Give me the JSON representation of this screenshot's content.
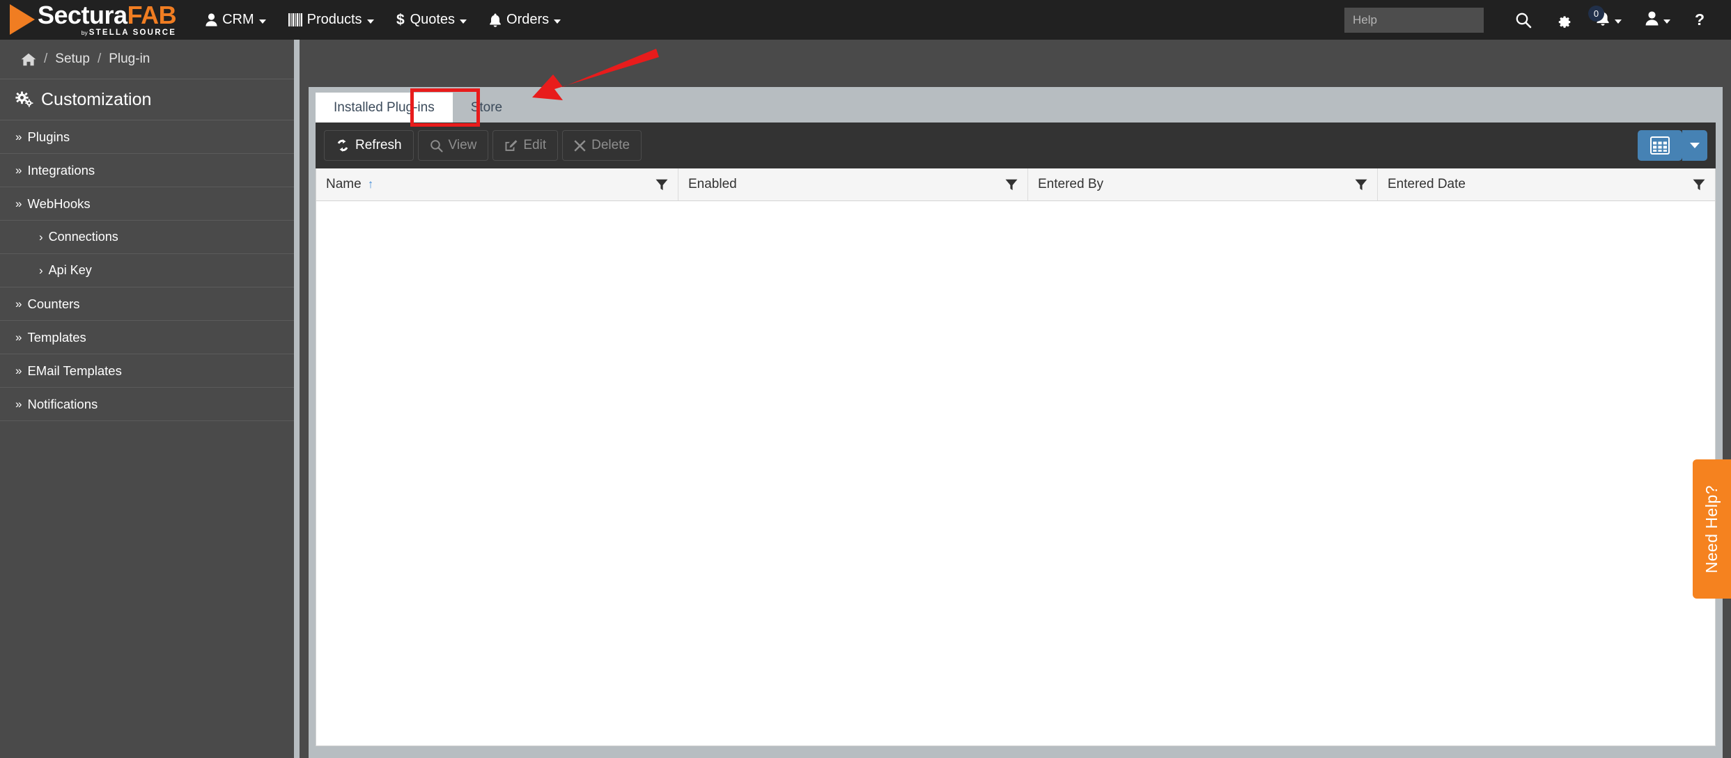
{
  "brand": {
    "name_part1": "Sectura",
    "name_part2": "FAB",
    "by_word": "by",
    "parent": "STELLA SOURCE",
    "accent_color": "#f07d22"
  },
  "topnav": {
    "items": [
      {
        "label": "CRM",
        "icon": "user-icon"
      },
      {
        "label": "Products",
        "icon": "barcode-icon"
      },
      {
        "label": "Quotes",
        "icon": "dollar-icon"
      },
      {
        "label": "Orders",
        "icon": "bell-icon"
      }
    ],
    "help_search_placeholder": "Help",
    "help_search_value": "",
    "notification_count": "0",
    "icons": [
      "search-icon",
      "gear-icon",
      "bell-icon",
      "user-icon",
      "question-icon"
    ]
  },
  "breadcrumb": {
    "home_icon": "home-icon",
    "separator": "/",
    "items": [
      "Setup",
      "Plug-in"
    ]
  },
  "sidebar": {
    "header": "Customization",
    "header_icon": "gears-icon",
    "items": [
      {
        "label": "Plugins",
        "chevron": "»",
        "level": 0
      },
      {
        "label": "Integrations",
        "chevron": "»",
        "level": 0
      },
      {
        "label": "WebHooks",
        "chevron": "»",
        "level": 0
      },
      {
        "label": "Connections",
        "chevron": "›",
        "level": 1
      },
      {
        "label": "Api Key",
        "chevron": "›",
        "level": 1
      },
      {
        "label": "Counters",
        "chevron": "»",
        "level": 0
      },
      {
        "label": "Templates",
        "chevron": "»",
        "level": 0
      },
      {
        "label": "EMail Templates",
        "chevron": "»",
        "level": 0
      },
      {
        "label": "Notifications",
        "chevron": "»",
        "level": 0
      }
    ]
  },
  "main": {
    "tabs": [
      {
        "label": "Installed Plug-ins",
        "active": true
      },
      {
        "label": "Store",
        "active": false,
        "highlighted": true
      }
    ],
    "highlight_color": "#e81c1c",
    "toolbar": {
      "buttons": [
        {
          "label": "Refresh",
          "icon": "refresh-icon",
          "enabled": true
        },
        {
          "label": "View",
          "icon": "magnifier-icon",
          "enabled": false
        },
        {
          "label": "Edit",
          "icon": "pencil-square-icon",
          "enabled": false
        },
        {
          "label": "Delete",
          "icon": "close-x-icon",
          "enabled": false
        }
      ],
      "grid_button_icon": "table-grid-icon",
      "grid_button_caret": "chevron-down-icon",
      "grid_button_color": "#4682b4"
    },
    "table": {
      "columns": [
        {
          "label": "Name",
          "sorted": "asc",
          "sort_glyph": "↑",
          "filter_icon": "filter-funnel-icon"
        },
        {
          "label": "Enabled",
          "sorted": "",
          "sort_glyph": "",
          "filter_icon": "filter-funnel-icon"
        },
        {
          "label": "Entered By",
          "sorted": "",
          "sort_glyph": "",
          "filter_icon": "filter-funnel-icon"
        },
        {
          "label": "Entered Date",
          "sorted": "",
          "sort_glyph": "",
          "filter_icon": "filter-funnel-icon"
        }
      ],
      "rows": []
    }
  },
  "need_help": {
    "label": "Need Help?",
    "color": "#f5821f"
  }
}
